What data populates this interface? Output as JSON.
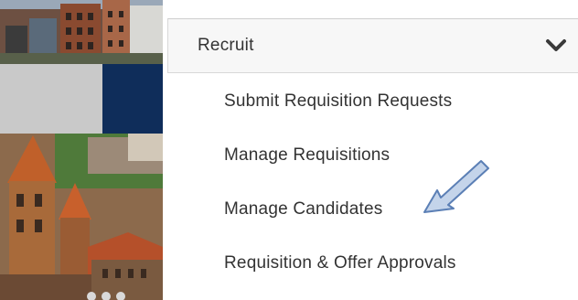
{
  "menu": {
    "header_label": "Recruit",
    "items": [
      {
        "label": "Submit Requisition Requests"
      },
      {
        "label": "Manage Requisitions"
      },
      {
        "label": "Manage Candidates"
      },
      {
        "label": "Requisition & Offer Approvals"
      }
    ]
  },
  "colors": {
    "navy_panel": "#0f2d5a",
    "gray_panel": "#c9c9c9",
    "arrow_fill": "#c4d4ea",
    "arrow_stroke": "#5b7fb5"
  },
  "icons": {
    "expand": "chevron-down-icon",
    "pointer": "callout-arrow-icon"
  }
}
